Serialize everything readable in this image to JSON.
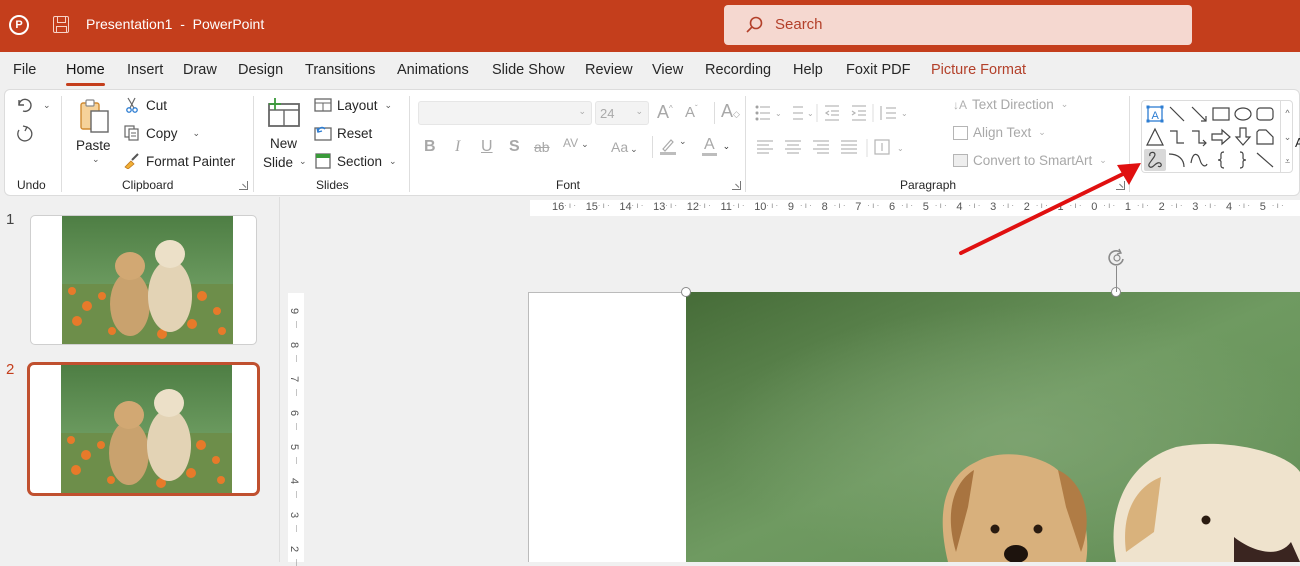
{
  "titlebar": {
    "app_icon": "powerpoint-logo-icon",
    "save_icon": "save-icon",
    "document_name": "Presentation1",
    "separator": "-",
    "app_name": "PowerPoint",
    "search_placeholder": "Search",
    "colors": {
      "brand": "#c43e1c",
      "search_bg": "#f5d8d0"
    }
  },
  "menu_tabs": [
    {
      "label": "File"
    },
    {
      "label": "Home",
      "active": true
    },
    {
      "label": "Insert"
    },
    {
      "label": "Draw"
    },
    {
      "label": "Design"
    },
    {
      "label": "Transitions"
    },
    {
      "label": "Animations"
    },
    {
      "label": "Slide Show"
    },
    {
      "label": "Review"
    },
    {
      "label": "View"
    },
    {
      "label": "Recording"
    },
    {
      "label": "Help"
    },
    {
      "label": "Foxit PDF"
    },
    {
      "label": "Picture Format",
      "contextual": true
    }
  ],
  "ribbon": {
    "undo": {
      "group_label": "Undo",
      "undo_icon": "undo-icon",
      "redo_icon": "redo-icon"
    },
    "clipboard": {
      "group_label": "Clipboard",
      "paste": "Paste",
      "cut": "Cut",
      "copy": "Copy",
      "format_painter": "Format Painter"
    },
    "slides": {
      "group_label": "Slides",
      "new_slide_line1": "New",
      "new_slide_line2": "Slide",
      "layout": "Layout",
      "reset": "Reset",
      "section": "Section"
    },
    "font": {
      "group_label": "Font",
      "font_name_value": "",
      "font_size_value": "24",
      "grow_font": "A",
      "shrink_font": "A",
      "bold": "B",
      "italic": "I",
      "underline": "U",
      "shadow": "S",
      "strikethrough": "ab",
      "char_spacing": "AV",
      "change_case": "Aa",
      "font_color": "A"
    },
    "paragraph": {
      "group_label": "Paragraph",
      "text_direction": "Text Direction",
      "align_text": "Align Text",
      "convert_smartart": "Convert to SmartArt"
    },
    "drawing": {
      "shapes": [
        "text-box",
        "line",
        "arrow-line",
        "rectangle",
        "oval",
        "rounded-rectangle",
        "triangle",
        "elbow-connector",
        "elbow-arrow-connector",
        "right-arrow",
        "down-arrow",
        "snip-rectangle",
        "freeform-scribble",
        "arc",
        "curve",
        "left-brace",
        "right-brace",
        "diagonal-line"
      ],
      "selected_shape": "freeform-scribble",
      "overflow_letter": "A"
    }
  },
  "thumbnails": [
    {
      "number": "1",
      "active": false
    },
    {
      "number": "2",
      "active": true
    }
  ],
  "rulers": {
    "horizontal": [
      "16",
      "15",
      "14",
      "13",
      "12",
      "11",
      "10",
      "9",
      "8",
      "7",
      "6",
      "5",
      "4",
      "3",
      "2",
      "1",
      "0",
      "1",
      "2",
      "3",
      "4",
      "5"
    ],
    "vertical": [
      "9",
      "8",
      "7",
      "6",
      "5",
      "4",
      "3",
      "2"
    ]
  },
  "annotation": {
    "arrow_color": "#e01010",
    "points_to": "freeform-scribble"
  }
}
